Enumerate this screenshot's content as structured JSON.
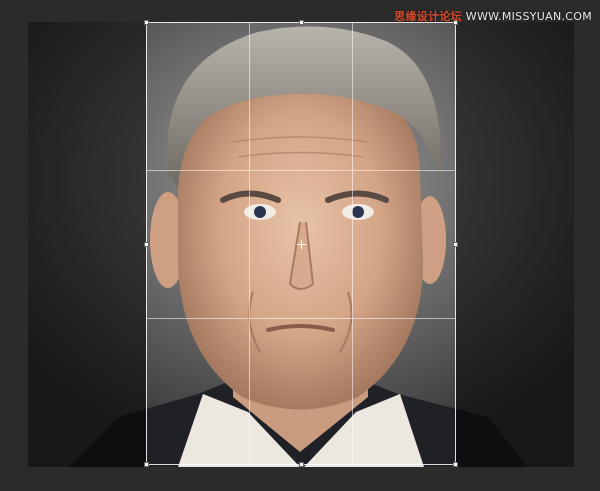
{
  "watermark": {
    "brand": "思缘设计论坛",
    "site": "WWW.MISSYUAN.COM"
  },
  "photo": {
    "subject_icon": "portrait-photo",
    "crop_grid": "rule-of-thirds"
  },
  "colors": {
    "workspace_bg": "#2b2b2b",
    "crop_border": "#ffffff",
    "watermark_brand": "#d94b2b"
  }
}
